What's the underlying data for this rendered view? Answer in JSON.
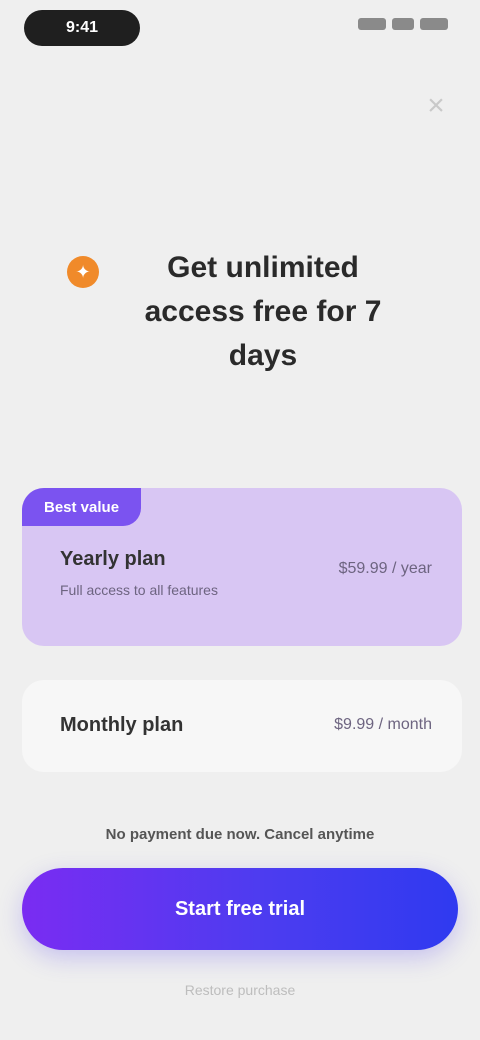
{
  "status_bar": {
    "time": "9:41",
    "icons": [
      "signal-icon",
      "wifi-icon",
      "battery-icon"
    ]
  },
  "close_icon": "close-icon",
  "headline": {
    "icon": "sparkle-icon",
    "text": "Get unlimited access free for 7 days"
  },
  "plans": {
    "annual": {
      "badge": "Best value",
      "name": "Yearly plan",
      "description": "Full access to all features",
      "price": "$59.99 / year"
    },
    "monthly": {
      "name": "Monthly plan",
      "price": "$9.99 / month"
    }
  },
  "trial_note": "No payment due now. Cancel anytime",
  "cta": {
    "label": "Start free trial"
  },
  "restore": {
    "label": "Restore purchase"
  },
  "colors": {
    "background": "#efefef",
    "card_selected": "#d8c6f3",
    "badge": "#7b53f0",
    "cta_start": "#7a2cf2",
    "cta_end": "#2f3af0",
    "headline_icon": "#f08a2a"
  }
}
